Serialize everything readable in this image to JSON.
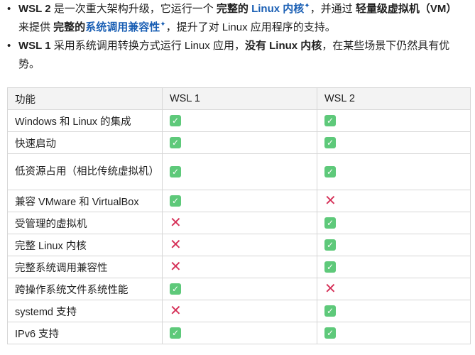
{
  "bullets": [
    {
      "b1_strong": "WSL 2",
      "b1_t1": " 是一次重大架构升级，它运行一个 ",
      "b1_strong2": "完整的 ",
      "b1_link1": "Linux 内核",
      "b1_t2": "，并通过 ",
      "b1_strong3": "轻量级虚拟机（VM）",
      "b1_t3": " 来提供 ",
      "b1_strong4": "完整的",
      "b1_link2": "系统调用兼容性",
      "b1_t4": "，提升了对 Linux 应用程序的支持。"
    },
    {
      "b2_strong": "WSL 1",
      "b2_t1": " 采用系统调用转换方式运行 Linux 应用，",
      "b2_strong2": "没有 Linux 内核",
      "b2_t2": "，在某些场景下仍然具有优势。"
    }
  ],
  "table": {
    "headers": [
      "功能",
      "WSL 1",
      "WSL 2"
    ],
    "rows": [
      {
        "feature": "Windows 和 Linux 的集成",
        "wsl1": "yes",
        "wsl2": "yes"
      },
      {
        "feature": "快速启动",
        "wsl1": "yes",
        "wsl2": "yes"
      },
      {
        "feature": "低资源占用（相比传统虚拟机）",
        "wsl1": "yes",
        "wsl2": "yes"
      },
      {
        "feature": "兼容 VMware 和 VirtualBox",
        "wsl1": "yes",
        "wsl2": "no"
      },
      {
        "feature": "受管理的虚拟机",
        "wsl1": "no",
        "wsl2": "yes"
      },
      {
        "feature": "完整 Linux 内核",
        "wsl1": "no",
        "wsl2": "yes"
      },
      {
        "feature": "完整系统调用兼容性",
        "wsl1": "no",
        "wsl2": "yes"
      },
      {
        "feature": "跨操作系统文件系统性能",
        "wsl1": "yes",
        "wsl2": "no"
      },
      {
        "feature": "systemd 支持",
        "wsl1": "no",
        "wsl2": "yes"
      },
      {
        "feature": "IPv6 支持",
        "wsl1": "yes",
        "wsl2": "yes"
      }
    ]
  },
  "icons": {
    "yes": "check-mark-icon",
    "no": "cross-mark-icon",
    "yes_color": "#5ec97a",
    "no_color": "#d6335a"
  }
}
